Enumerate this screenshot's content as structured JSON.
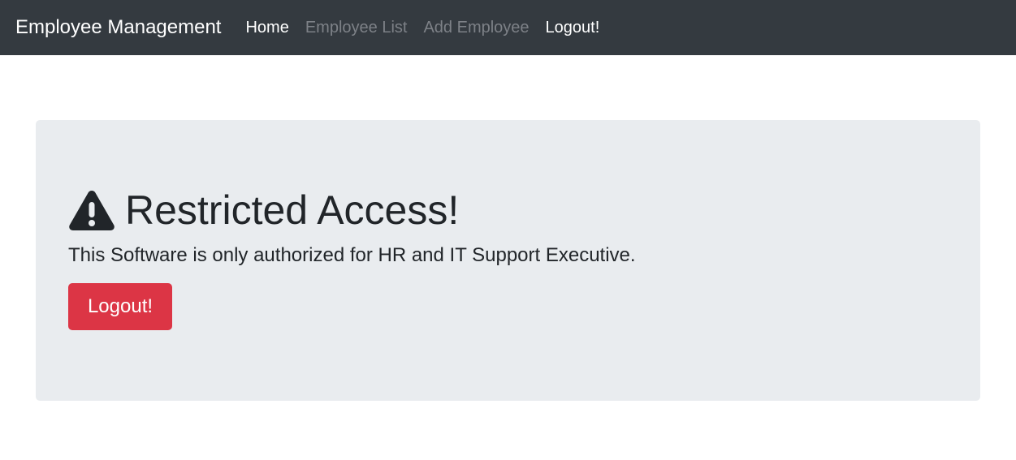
{
  "navbar": {
    "brand": "Employee Management",
    "links": [
      {
        "label": "Home",
        "color": "#ffffff"
      },
      {
        "label": "Employee List",
        "color": "#7d8187"
      },
      {
        "label": "Add Employee",
        "color": "#7d8187"
      },
      {
        "label": "Logout!",
        "color": "#ffffff"
      }
    ]
  },
  "jumbotron": {
    "icon": "warning-icon",
    "heading": "Restricted Access!",
    "message": "This Software is only authorized for HR and IT Support Executive.",
    "button_label": "Logout!"
  },
  "colors": {
    "navbar_bg": "#343a40",
    "jumbotron_bg": "#e9ecef",
    "danger": "#dc3545",
    "text_dark": "#212529"
  }
}
